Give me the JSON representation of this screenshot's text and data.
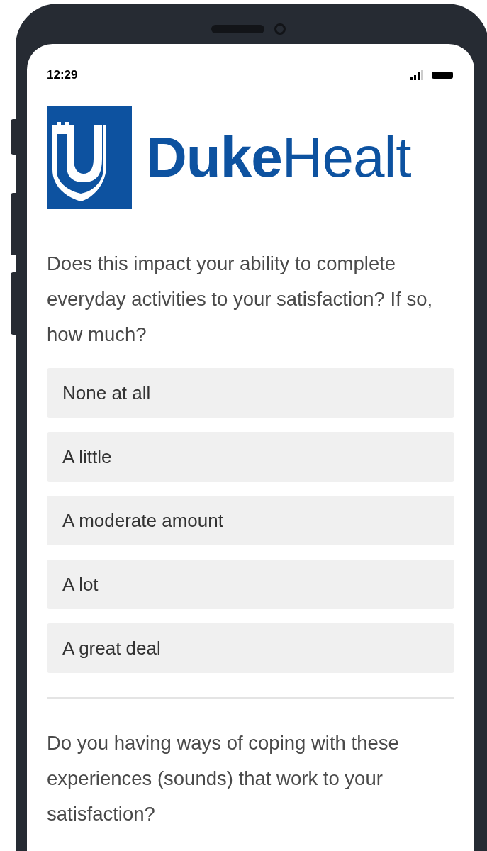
{
  "status_bar": {
    "time": "12:29"
  },
  "logo": {
    "text": "**Duke**Healt"
  },
  "questions": [
    {
      "text": "Does this impact your ability to complete everyday activities to your satisfaction? If so, how much?",
      "options": [
        {
          "label": "None at all"
        },
        {
          "label": "A little"
        },
        {
          "label": "A moderate amount"
        },
        {
          "label": "A lot"
        },
        {
          "label": "A great deal"
        }
      ]
    },
    {
      "text": "Do you having ways of coping with these experiences (sounds) that work to your satisfaction?"
    }
  ]
}
